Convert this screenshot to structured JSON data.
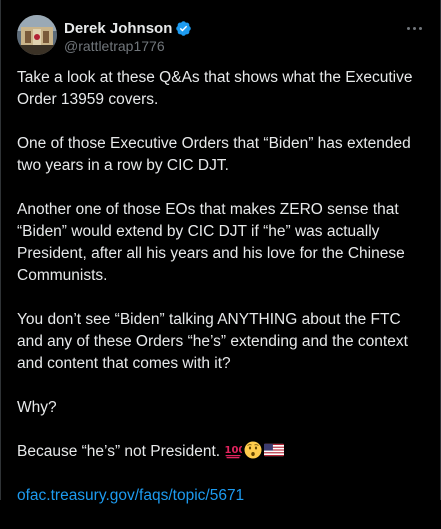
{
  "author": {
    "display_name": "Derek Johnson",
    "handle": "@rattletrap1776",
    "verified": true
  },
  "post": {
    "paragraphs": [
      "Take a look at these Q&As that shows what the Executive Order 13959 covers.",
      "One of those Executive Orders that “Biden” has extended two years in a row by CIC DJT.",
      "Another one of those EOs that makes ZERO sense that “Biden” would extend by CIC DJT if “he” was actually President, after all his years and his love for the Chinese Communists.",
      "You don’t see “Biden” talking ANYTHING about the FTC and any of these Orders “he’s” extending and the context and content that comes with it?",
      "Why?"
    ],
    "closing_text": "Because “he’s” not President.",
    "closing_emojis": [
      "hundred-points-emoji",
      "hushed-face-emoji",
      "us-flag-emoji"
    ],
    "link_text": "ofac.treasury.gov/faqs/topic/5671"
  },
  "icons": {
    "verified_badge": "verified-badge-icon",
    "more_options": "more-options-icon"
  },
  "colors": {
    "background": "#000000",
    "text": "#e7e9ea",
    "secondary_text": "#71767b",
    "link": "#1d9bf0",
    "verified": "#1d9bf0"
  }
}
